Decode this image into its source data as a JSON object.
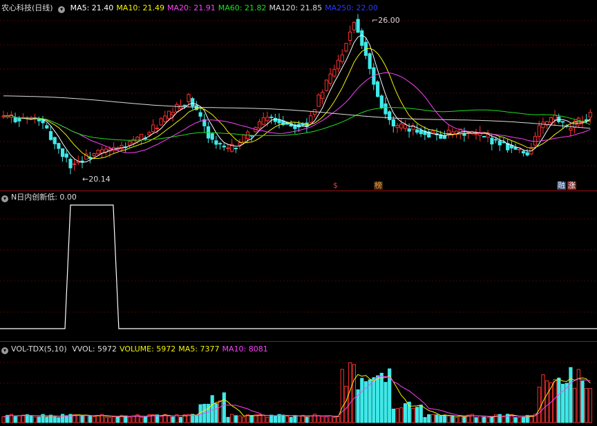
{
  "main": {
    "stock_name": "农心科技",
    "period": "(日线)",
    "indicators": [
      {
        "label": "MA5: 21.40",
        "color": "#ffffff"
      },
      {
        "label": "MA10: 21.49",
        "color": "#f4f400"
      },
      {
        "label": "MA20: 21.91",
        "color": "#ff40ff"
      },
      {
        "label": "MA60: 21.82",
        "color": "#20e020"
      },
      {
        "label": "MA120: 21.85",
        "color": "#dddddd"
      },
      {
        "label": "MA250: 22.00",
        "color": "#2a3aff"
      }
    ],
    "high_label": "26.00",
    "low_label": "20.14",
    "markers": [
      {
        "text": "$",
        "color": "#ff3030",
        "bg": "transparent"
      },
      {
        "text": "榜",
        "color": "#ffa040",
        "bg": "#3a2a10"
      },
      {
        "text": "融",
        "color": "#ffffff",
        "bg": "#204070"
      },
      {
        "text": "涨",
        "color": "#ffffff",
        "bg": "#802020"
      }
    ]
  },
  "indicator_panel": {
    "title": "N日内创新低",
    "value": ": 0.00"
  },
  "volume_panel": {
    "title": "VOL-TDX(5,10)",
    "items": [
      {
        "label": "VVOL: 5972",
        "color": "#dddddd"
      },
      {
        "label": "VOLUME: 5972",
        "color": "#f4f400"
      },
      {
        "label": "MA5: 7377",
        "color": "#f4f400"
      },
      {
        "label": "MA10: 8081",
        "color": "#ff40ff"
      }
    ]
  },
  "chart_data": {
    "type": "candlestick",
    "price_range": [
      20.14,
      26.0
    ],
    "highest": 26.0,
    "lowest": 20.14,
    "indicator_signal": {
      "active_from_bar": 10,
      "active_to_bar": 17,
      "value_when_active": 1,
      "value_otherwise": 0
    }
  },
  "colors": {
    "up": "#ff3030",
    "down": "#40e8e8",
    "grid": "#5a0000",
    "separator": "#a81010"
  }
}
